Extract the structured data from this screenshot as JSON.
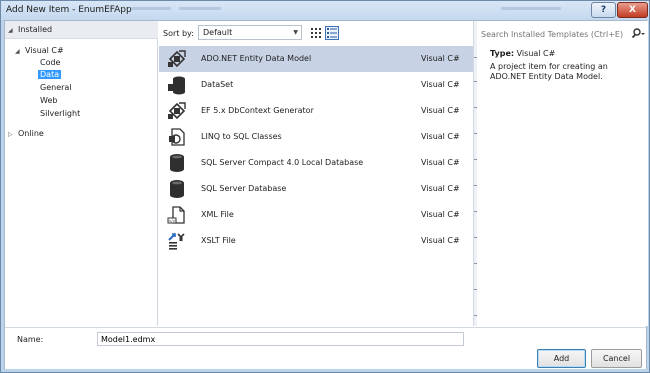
{
  "window": {
    "title": "Add New Item - EnumEFApp",
    "help_label": "?",
    "close_label": "X"
  },
  "tree": {
    "header": "Installed",
    "items": [
      {
        "label": "Visual C#"
      },
      {
        "label": "Code"
      },
      {
        "label": "Data"
      },
      {
        "label": "General"
      },
      {
        "label": "Web"
      },
      {
        "label": "Silverlight"
      },
      {
        "label": "Online"
      }
    ]
  },
  "toolbar": {
    "sort_label": "Sort by:",
    "sort_value": "Default"
  },
  "templates": [
    {
      "name": "ADO.NET Entity Data Model",
      "language": "Visual C#",
      "icon": "entity-model-icon"
    },
    {
      "name": "DataSet",
      "language": "Visual C#",
      "icon": "dataset-icon"
    },
    {
      "name": "EF 5.x DbContext Generator",
      "language": "Visual C#",
      "icon": "dbcontext-generator-icon"
    },
    {
      "name": "LINQ to SQL Classes",
      "language": "Visual C#",
      "icon": "linq-sql-icon"
    },
    {
      "name": "SQL Server Compact 4.0 Local Database",
      "language": "Visual C#",
      "icon": "database-icon"
    },
    {
      "name": "SQL Server Database",
      "language": "Visual C#",
      "icon": "database-icon"
    },
    {
      "name": "XML File",
      "language": "Visual C#",
      "icon": "xml-file-icon"
    },
    {
      "name": "XSLT File",
      "language": "Visual C#",
      "icon": "xslt-file-icon"
    }
  ],
  "details": {
    "search_placeholder": "Search Installed Templates (Ctrl+E)",
    "type_label": "Type:",
    "type_value": "Visual C#",
    "description": "A project item for creating an ADO.NET Entity Data Model."
  },
  "footer": {
    "name_label": "Name:",
    "name_value": "Model1.edmx",
    "add_label": "Add",
    "cancel_label": "Cancel"
  },
  "colors": {
    "selection": "#3399ff",
    "selected_row": "#c7d2e4",
    "title_bar": "#c4d8ef"
  }
}
